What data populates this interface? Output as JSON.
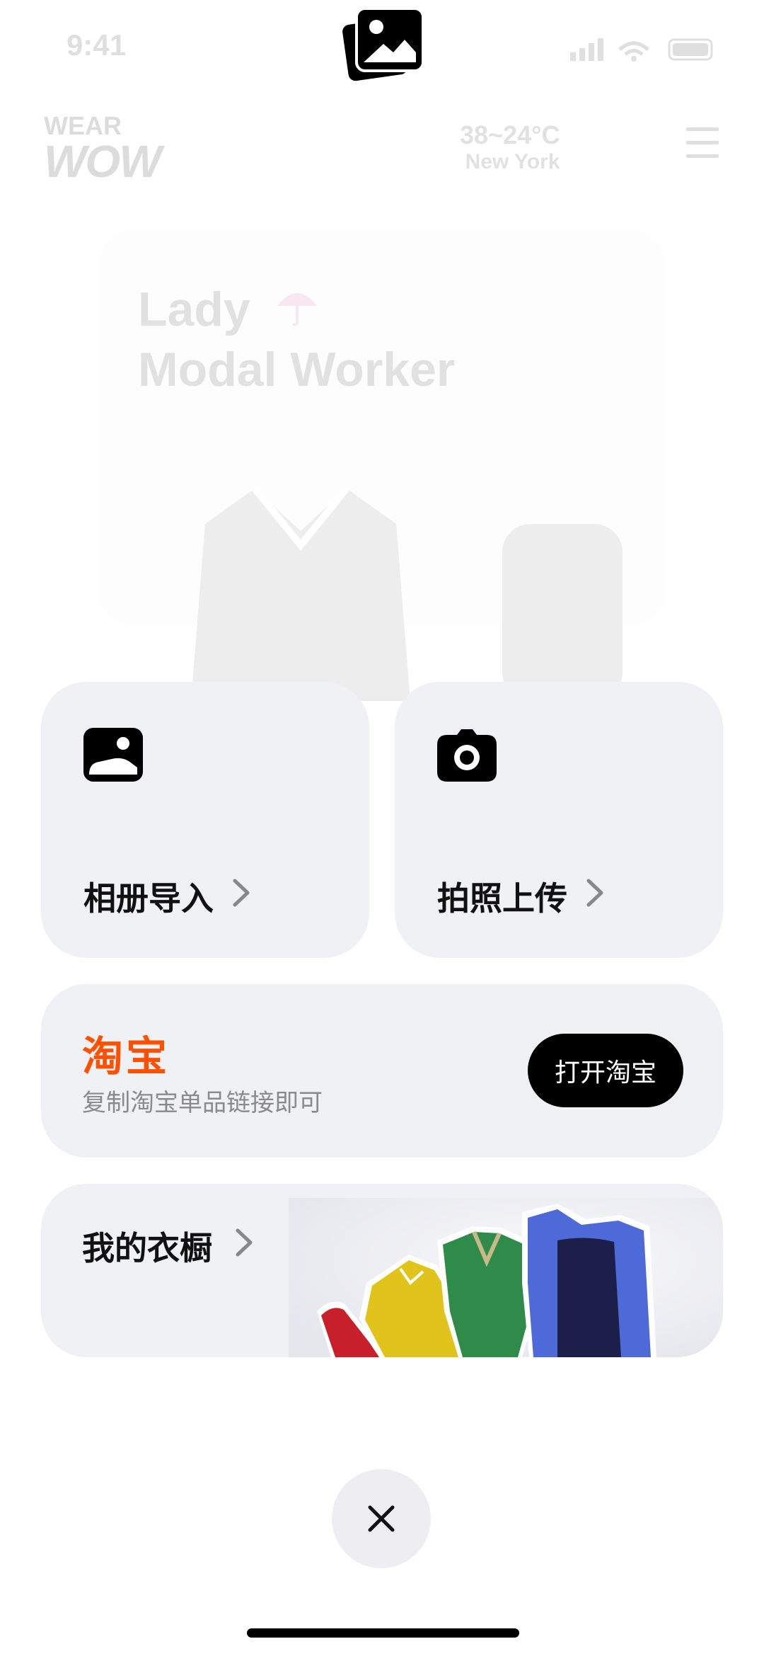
{
  "status_bar": {
    "time": "9:41"
  },
  "header": {
    "logo_top": "WEAR",
    "logo_bottom": "WOW",
    "temperature": "38~24°C",
    "city": "New York"
  },
  "background_card": {
    "title_line1": "Lady",
    "title_line2": "Modal Worker"
  },
  "actions": {
    "album_label": "相册导入",
    "camera_label": "拍照上传"
  },
  "taobao": {
    "logo_text": "淘宝",
    "subtitle": "复制淘宝单品链接即可",
    "button_label": "打开淘宝",
    "brand_color": "#ff5000"
  },
  "wardrobe": {
    "label": "我的衣橱"
  },
  "icons": {
    "top": "gallery-icon",
    "album": "photo-icon",
    "camera": "camera-icon",
    "close": "close-icon"
  }
}
